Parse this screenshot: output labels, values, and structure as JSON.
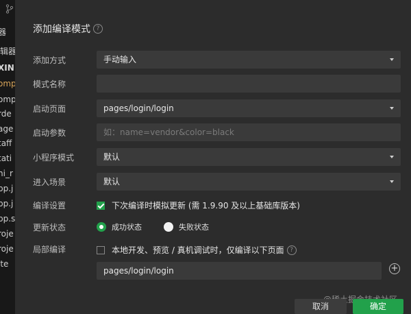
{
  "sidebar": {
    "items": [
      "器",
      "编辑器",
      "XIN",
      "omp",
      "omp",
      "rde",
      "age",
      "taff",
      "tati",
      "ni_r",
      "pp.j",
      "pp.j",
      "pp.s",
      "roje",
      "roje",
      "ite"
    ]
  },
  "dialog": {
    "title": "添加编译模式",
    "fields": {
      "add_method_label": "添加方式",
      "add_method_value": "手动输入",
      "mode_name_label": "模式名称",
      "mode_name_value": "",
      "start_page_label": "启动页面",
      "start_page_value": "pages/login/login",
      "start_params_label": "启动参数",
      "start_params_placeholder": "如：name=vendor&color=black",
      "mp_mode_label": "小程序模式",
      "mp_mode_value": "默认",
      "scene_label": "进入场景",
      "scene_value": "默认",
      "compile_settings_label": "编译设置",
      "compile_settings_option": "下次编译时模拟更新 (需 1.9.90 及以上基础库版本)",
      "update_status_label": "更新状态",
      "update_success": "成功状态",
      "update_fail": "失败状态",
      "partial_compile_label": "局部编译",
      "partial_compile_option": "本地开发、预览 / 真机调试时，仅编译以下页面",
      "partial_page_value": "pages/login/login"
    },
    "buttons": {
      "cancel": "取消",
      "ok": "确定"
    }
  },
  "watermark": "@稀土掘金技术社区",
  "colors": {
    "accent": "#22a14b",
    "dialog_bg": "#2c2c2c",
    "field_bg": "#3a3a3a"
  }
}
